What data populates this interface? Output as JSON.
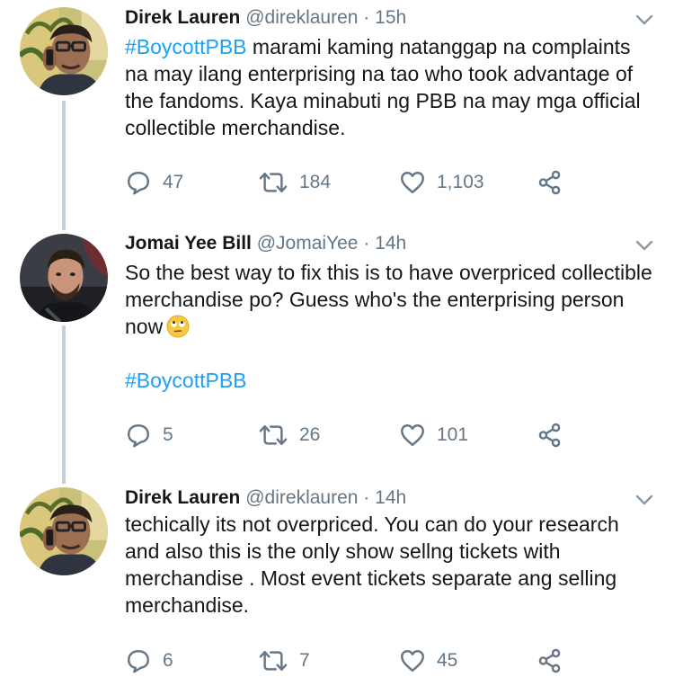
{
  "tweets": [
    {
      "name": "Direk Lauren",
      "handle": "@direklauren",
      "separator": "·",
      "time": "15h",
      "hashtag": "#BoycottPBB",
      "text": " marami kaming natanggap na complaints na may ilang  enterprising na tao who took advantage of the fandoms. Kaya minabuti ng PBB na may mga official collectible merchandise.",
      "replies": "47",
      "retweets": "184",
      "likes": "1,103"
    },
    {
      "name": "Jomai Yee Bill",
      "handle": "@JomaiYee",
      "separator": "·",
      "time": "14h",
      "text": "So the best way to fix this is to have overpriced collectible merchandise po? Guess who's the  enterprising person now",
      "emoji": "face-with-rolling-eyes",
      "hashtag": "#BoycottPBB",
      "replies": "5",
      "retweets": "26",
      "likes": "101"
    },
    {
      "name": "Direk Lauren",
      "handle": "@direklauren",
      "separator": "·",
      "time": "14h",
      "text": "techically its not overpriced. You can do your research and also this is the only show sellng tickets with merchandise . Most event tickets separate ang selling merchandise.",
      "replies": "6",
      "retweets": "7",
      "likes": "45"
    }
  ],
  "colors": {
    "text": "#14171a",
    "secondary": "#657786",
    "link": "#1da1f2",
    "thread_line": "#c4cfd6"
  },
  "icons": [
    "reply-icon",
    "retweet-icon",
    "like-icon",
    "share-icon",
    "chevron-down-icon"
  ]
}
